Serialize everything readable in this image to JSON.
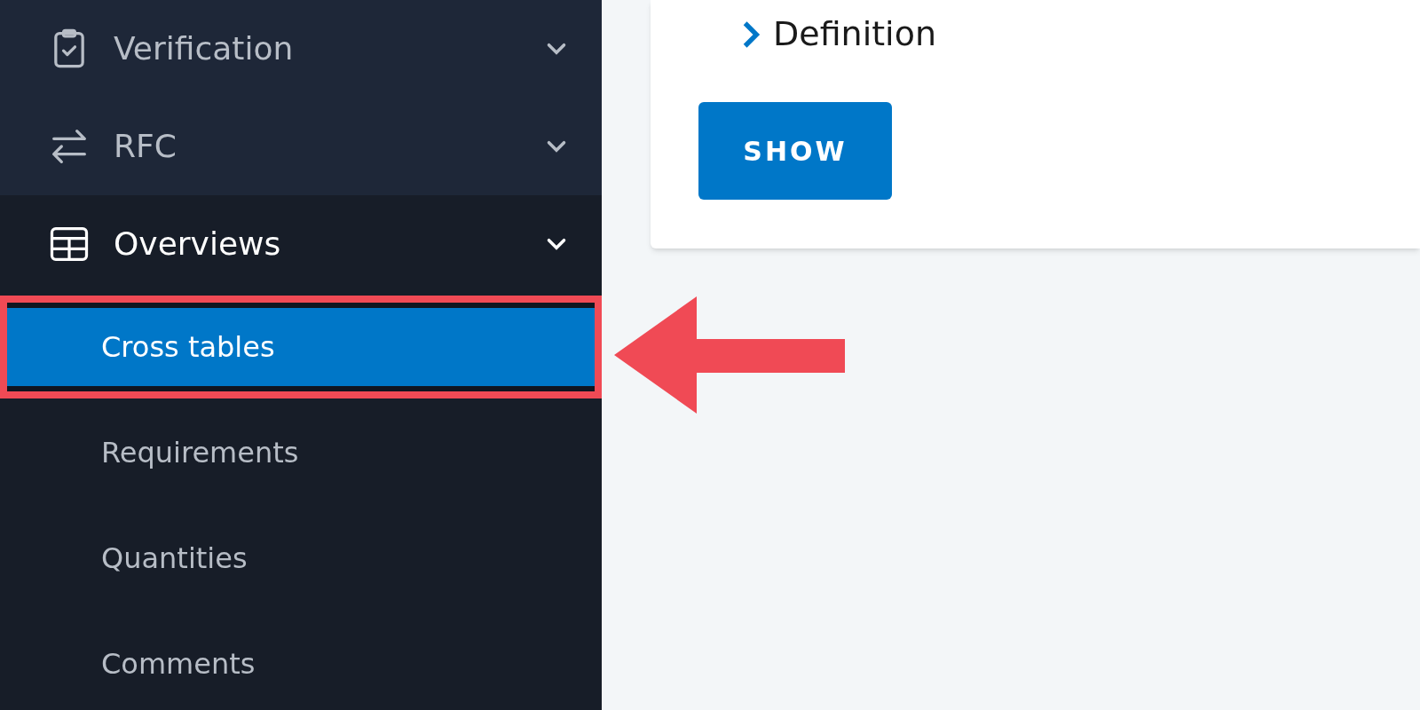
{
  "sidebar": {
    "sections": [
      {
        "label": "Verification",
        "expanded": false
      },
      {
        "label": "RFC",
        "expanded": false
      },
      {
        "label": "Overviews",
        "expanded": true,
        "children": [
          {
            "label": "Cross tables",
            "selected": true,
            "annotated": true
          },
          {
            "label": "Requirements",
            "selected": false,
            "annotated": false
          },
          {
            "label": "Quantities",
            "selected": false,
            "annotated": false
          },
          {
            "label": "Comments",
            "selected": false,
            "annotated": false
          }
        ]
      }
    ]
  },
  "card": {
    "link": "Definition",
    "button": "SHOW"
  }
}
